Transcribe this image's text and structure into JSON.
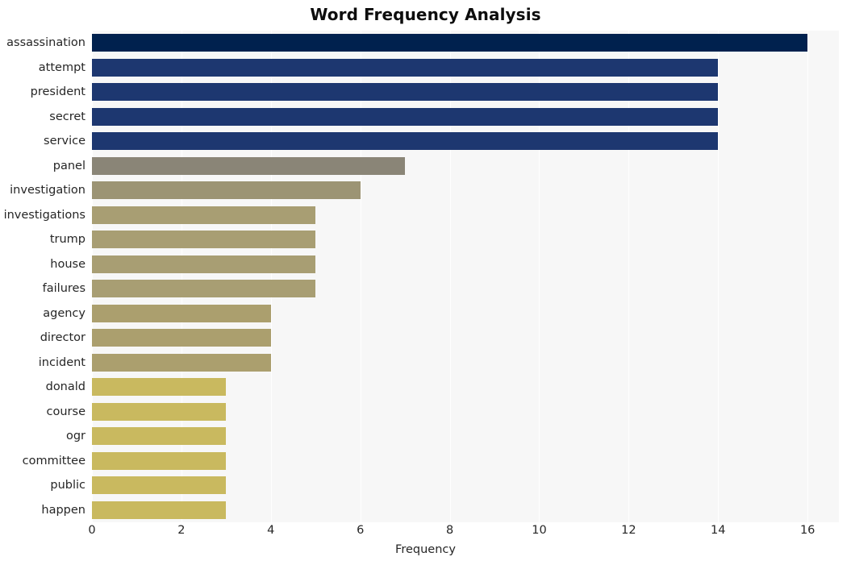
{
  "chart_data": {
    "type": "bar",
    "orientation": "horizontal",
    "title": "Word Frequency Analysis",
    "xlabel": "Frequency",
    "ylabel": "",
    "xlim": [
      0,
      16.7
    ],
    "ylim": [
      0,
      20
    ],
    "grid": true,
    "legend": null,
    "background": "#f7f7f7",
    "xticks": [
      0,
      2,
      4,
      6,
      8,
      10,
      12,
      14,
      16
    ],
    "xtick_labels": [
      "0",
      "2",
      "4",
      "6",
      "8",
      "10",
      "12",
      "14",
      "16"
    ],
    "categories": [
      "assassination",
      "attempt",
      "president",
      "secret",
      "service",
      "panel",
      "investigation",
      "investigations",
      "trump",
      "house",
      "failures",
      "agency",
      "director",
      "incident",
      "donald",
      "course",
      "ogr",
      "committee",
      "public",
      "happen"
    ],
    "values": [
      16,
      14,
      14,
      14,
      14,
      7,
      6,
      5,
      5,
      5,
      5,
      4,
      4,
      4,
      3,
      3,
      3,
      3,
      3,
      3
    ],
    "bar_colors": [
      "#00214e",
      "#1d3770",
      "#1d3770",
      "#1d3770",
      "#1d3770",
      "#8a8577",
      "#9c9474",
      "#a89e73",
      "#a89e73",
      "#a89e73",
      "#a89e73",
      "#ab9f6e",
      "#ab9f6e",
      "#ab9f6e",
      "#c9b95f",
      "#c9b95f",
      "#c9b95f",
      "#c9b95f",
      "#c9b95f",
      "#c9b95f"
    ]
  },
  "style": {
    "title_color": "#0d0d0d",
    "tick_color": "#262626",
    "grid_color": "#ffffff",
    "plot_background": "#f7f7f7",
    "figure_background": "#ffffff"
  }
}
